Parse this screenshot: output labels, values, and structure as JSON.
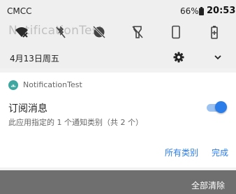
{
  "status_bar": {
    "carrier": "CMCC",
    "battery_percent": "66%",
    "time": "20:53"
  },
  "background_title": "NotificationTest",
  "quick_settings": {
    "icons": [
      "wifi-off-icon",
      "bluetooth-off-icon",
      "do-not-disturb-off-icon",
      "flashlight-off-icon",
      "auto-rotate-icon",
      "battery-saver-icon"
    ]
  },
  "date_row": {
    "date": "4月13日周五"
  },
  "notification": {
    "app_name": "NotificationTest",
    "channel_title": "订阅消息",
    "channel_description": "此应用指定的 1 个通知类别（共 2 个）",
    "toggle_on": true,
    "all_categories_label": "所有类别",
    "done_label": "完成"
  },
  "footer": {
    "clear_all_label": "全部清除"
  },
  "colors": {
    "accent": "#2b7de9",
    "toggle_track": "#9cc2f2",
    "bottom_bar": "#6f6f6f"
  }
}
